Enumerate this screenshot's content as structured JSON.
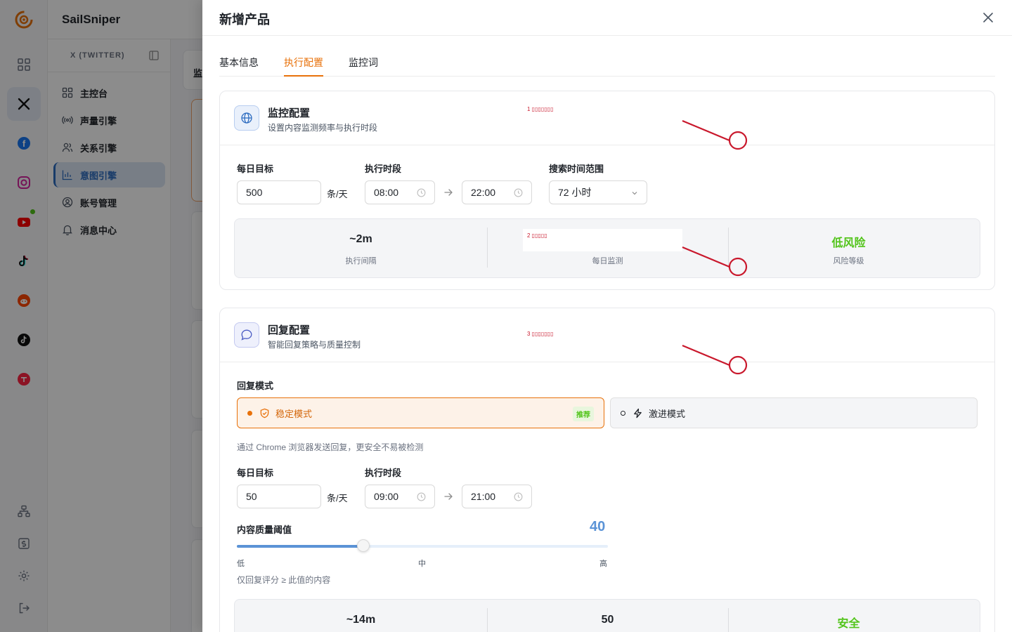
{
  "app": {
    "brand": "SailSniper",
    "platform_label": "X (TWITTER)",
    "nav": [
      {
        "label": "主控台",
        "icon": "dashboard-icon"
      },
      {
        "label": "声量引擎",
        "icon": "broadcast-icon"
      },
      {
        "label": "关系引擎",
        "icon": "users-icon"
      },
      {
        "label": "意图引擎",
        "icon": "chart-icon"
      },
      {
        "label": "账号管理",
        "icon": "account-icon"
      },
      {
        "label": "消息中心",
        "icon": "bell-icon"
      }
    ],
    "active_nav": "意图引擎",
    "main_fragment": "监"
  },
  "drawer": {
    "title": "新增产品",
    "tabs": [
      {
        "label": "基本信息"
      },
      {
        "label": "执行配置"
      },
      {
        "label": "监控词"
      }
    ],
    "active_tab": "执行配置"
  },
  "monitor": {
    "title": "监控配置",
    "subtitle": "设置内容监测频率与执行时段",
    "daily_target_label": "每日目标",
    "daily_target": "500",
    "unit": "条/天",
    "period_label": "执行时段",
    "start": "08:00",
    "end": "22:00",
    "range_label": "搜索时间范围",
    "range_value": "72 小时",
    "stats": [
      {
        "value": "~2m",
        "label": "执行间隔"
      },
      {
        "value": "",
        "label": "每日监测"
      },
      {
        "value": "低风险",
        "label": "风险等级"
      }
    ]
  },
  "reply": {
    "title": "回复配置",
    "subtitle": "智能回复策略与质量控制",
    "mode_label": "回复模式",
    "modes": [
      {
        "label": "稳定模式",
        "badge": "推荐",
        "selected": true
      },
      {
        "label": "激进模式",
        "selected": false
      }
    ],
    "mode_hint": "通过 Chrome 浏览器发送回复，更安全不易被检测",
    "daily_target_label": "每日目标",
    "daily_target": "50",
    "unit": "条/天",
    "period_label": "执行时段",
    "start": "09:00",
    "end": "21:00",
    "quality_label": "内容质量阈值",
    "quality_value": "40",
    "quality_fraction": 0.34,
    "ticks": [
      "低",
      "中",
      "高"
    ],
    "quality_hint": "仅回复评分 ≥ 此值的内容",
    "stats": [
      {
        "value": "~14m"
      },
      {
        "value": "50"
      },
      {
        "value": "安全"
      }
    ]
  },
  "annotations": [
    {
      "label": "1 ▯▯▯▯▯▯▯"
    },
    {
      "label": "2 ▯▯▯▯▯"
    },
    {
      "label": "3 ▯▯▯▯▯▯▯"
    }
  ],
  "colors": {
    "accent": "#e8710a",
    "primary": "#2d6cc0",
    "success": "#52c41a",
    "annotation": "#c9182c"
  }
}
